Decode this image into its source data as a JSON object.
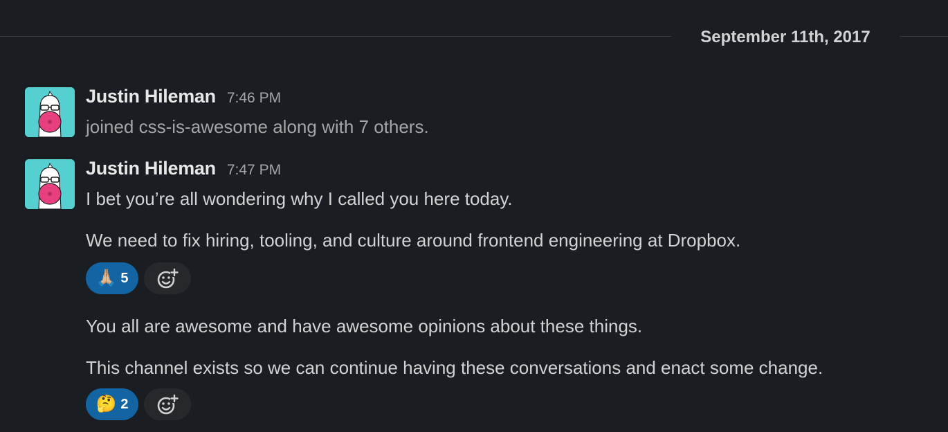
{
  "date_divider": "September 11th, 2017",
  "messages": [
    {
      "author": "Justin Hileman",
      "time": "7:46 PM",
      "lines": [
        "joined css-is-awesome along with 7 others."
      ]
    },
    {
      "author": "Justin Hileman",
      "time": "7:47 PM",
      "lines": [
        "I bet you’re all wondering why I called you here today.",
        "We need to fix hiring, tooling, and culture around frontend engineering at Dropbox."
      ],
      "reactions": [
        {
          "emoji": "🙏🏼",
          "icon": "folded-hands-icon",
          "count": "5"
        }
      ]
    },
    {
      "lines": [
        "You all are awesome and have awesome opinions about these things.",
        "This channel exists so we can continue having these conversations and enact some change."
      ],
      "reactions": [
        {
          "emoji": "🤔",
          "icon": "custom-thinking-emoji-icon",
          "count": "2"
        }
      ]
    }
  ],
  "colors": {
    "background": "#1a1d21",
    "reaction_active": "#1264a3",
    "avatar_bg": "#56cfd1",
    "mask": "#e8407f"
  }
}
